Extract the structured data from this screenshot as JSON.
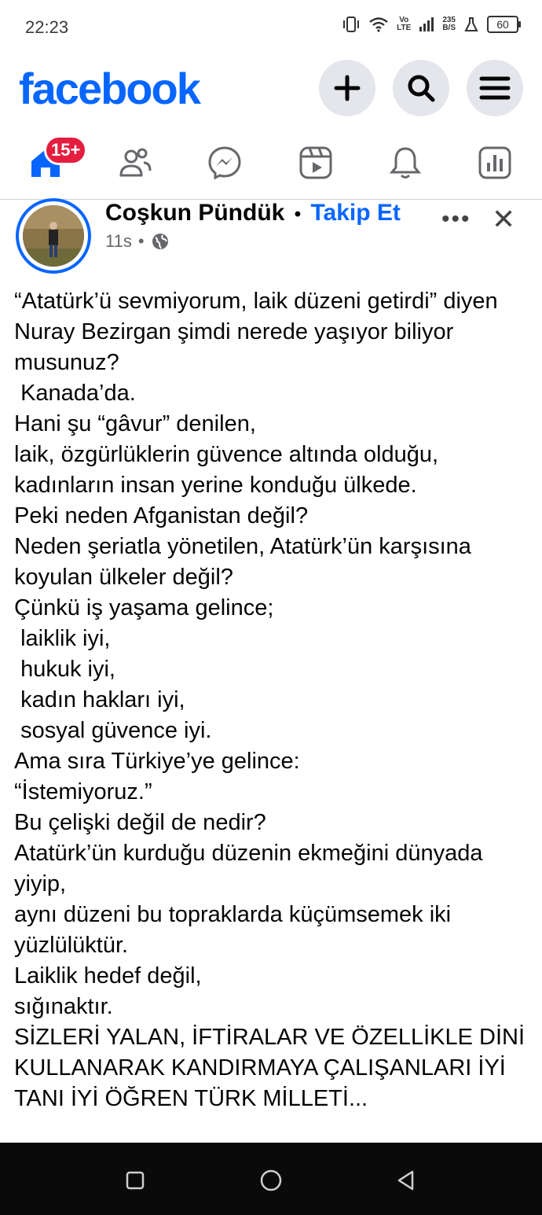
{
  "status_bar": {
    "time": "22:23",
    "net_type_top": "Vo",
    "net_type_bottom": "LTE",
    "speed_value": "235",
    "speed_unit": "B/S",
    "battery": "60"
  },
  "header": {
    "logo": "facebook",
    "buttons": [
      "plus-icon",
      "search-icon",
      "menu-icon"
    ]
  },
  "tabs": {
    "items": [
      "home-icon",
      "friends-icon",
      "messenger-icon",
      "video-icon",
      "notifications-icon",
      "dashboard-icon"
    ],
    "home_badge": "15+"
  },
  "post": {
    "author": "Coşkun Pündük",
    "separator": "•",
    "follow_label": "Takip Et",
    "time": "11s",
    "meta_dot": "•",
    "more_label": "•••",
    "close_label": "✕",
    "text": "“Atatürk’ü sevmiyorum, laik düzeni getirdi” diyen Nuray Bezirgan şimdi nerede yaşıyor biliyor musunuz?\n Kanada’da.\nHani şu “gâvur” denilen,\nlaik, özgürlüklerin güvence altında olduğu, kadınların insan yerine konduğu ülkede.\nPeki neden Afganistan değil?\nNeden şeriatla yönetilen, Atatürk’ün karşısına koyulan ülkeler değil?\nÇünkü iş yaşama gelince;\n laiklik iyi,\n hukuk iyi,\n kadın hakları iyi,\n sosyal güvence iyi.\nAma sıra Türkiye’ye gelince:\n“İstemiyoruz.”\nBu çelişki değil de nedir?\nAtatürk’ün kurduğu düzenin ekmeğini dünyada yiyip,\naynı düzeni bu topraklarda küçümsemek iki yüzlülüktür.\nLaiklik hedef değil,\nsığınaktır.\nSİZLERİ YALAN, İFTİRALAR VE ÖZELLİKLE DİNİ KULLANARAK KANDIRMAYA ÇALIŞANLARI İYİ TANI İYİ ÖĞREN TÜRK MİLLETİ..."
  },
  "colors": {
    "brand": "#0866ff",
    "badge": "#e41e3f",
    "secondary_text": "#65676b"
  }
}
